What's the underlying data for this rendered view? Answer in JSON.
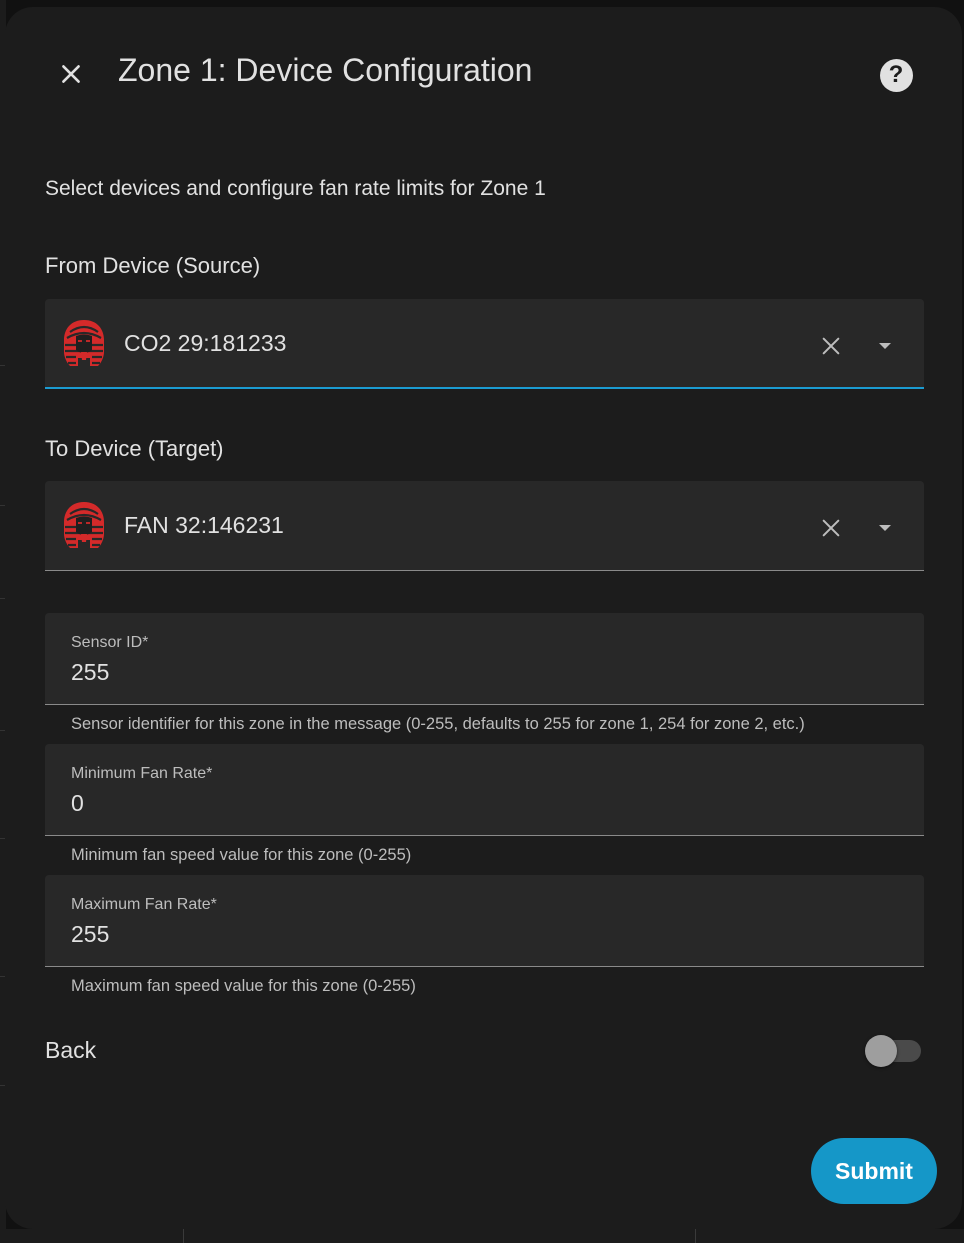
{
  "dialog": {
    "title": "Zone 1: Device Configuration",
    "description": "Select devices and configure fan rate limits for Zone 1"
  },
  "icons": {
    "close": "close-icon",
    "help": "help-circle-icon",
    "device": "pharaoh-device-icon",
    "clear": "clear-icon",
    "dropdown": "menu-down-icon"
  },
  "source": {
    "label": "From Device (Source)",
    "value": "CO2 29:181233"
  },
  "target": {
    "label": "To Device (Target)",
    "value": "FAN 32:146231"
  },
  "fields": {
    "sensor_id": {
      "label": "Sensor ID*",
      "value": "255",
      "helper": "Sensor identifier for this zone in the message (0-255, defaults to 255 for zone 1, 254 for zone 2, etc.)"
    },
    "min_fan_rate": {
      "label": "Minimum Fan Rate*",
      "value": "0",
      "helper": "Minimum fan speed value for this zone (0-255)"
    },
    "max_fan_rate": {
      "label": "Maximum Fan Rate*",
      "value": "255",
      "helper": "Maximum fan speed value for this zone (0-255)"
    }
  },
  "back": {
    "label": "Back",
    "enabled": false
  },
  "submit": {
    "label": "Submit"
  },
  "colors": {
    "accent": "#1b9bd1",
    "submit_bg": "#1597c8",
    "device_icon": "#d42a2a",
    "surface": "#1c1c1c",
    "field": "#282828"
  }
}
